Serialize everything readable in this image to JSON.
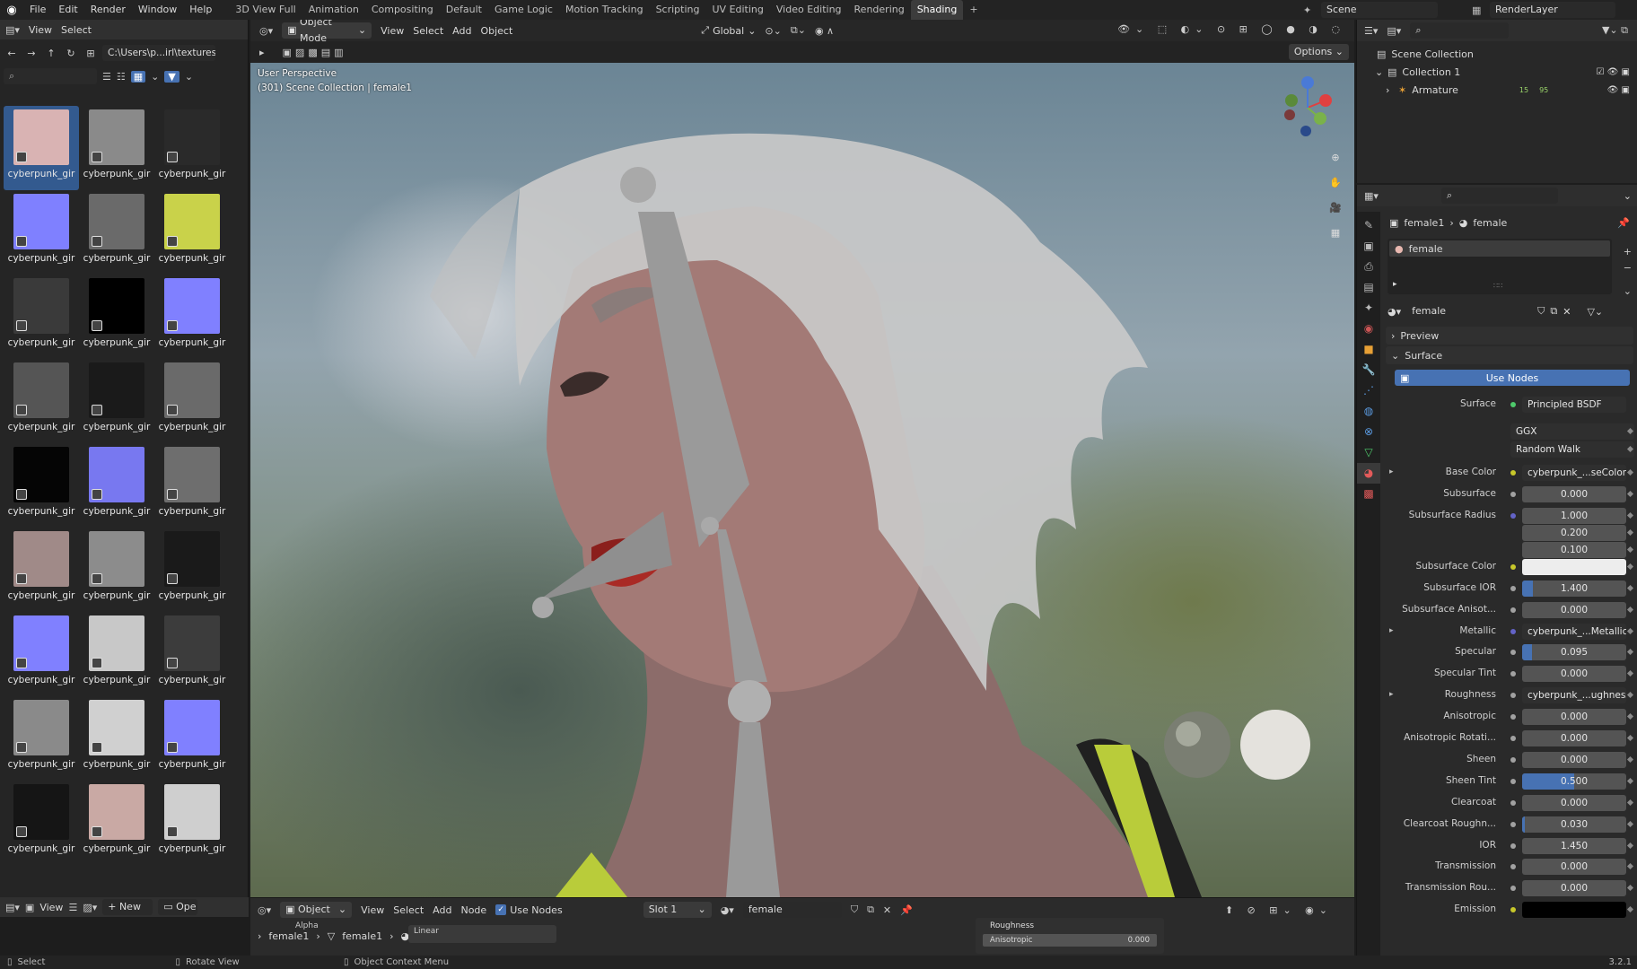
{
  "topbar": {
    "menus": [
      "File",
      "Edit",
      "Render",
      "Window",
      "Help"
    ],
    "workspaces": [
      "3D View Full",
      "Animation",
      "Compositing",
      "Default",
      "Game Logic",
      "Motion Tracking",
      "Scripting",
      "UV Editing",
      "Video Editing",
      "Rendering",
      "Shading"
    ],
    "active_workspace": "Shading",
    "add_workspace": "+",
    "scene_label": "Scene",
    "renderlayer_label": "RenderLayer"
  },
  "filebrowser": {
    "menus": [
      "View",
      "Select"
    ],
    "path": "C:\\Users\\p...irl\\textures\\",
    "search_placeholder": "",
    "thumbnails": [
      {
        "label": "cyberpunk_gir",
        "color": "#d9b3b3"
      },
      {
        "label": "cyberpunk_gir",
        "color": "#8a8a8a"
      },
      {
        "label": "cyberpunk_gir",
        "color": "#2a2a2a"
      },
      {
        "label": "cyberpunk_gir",
        "color": "#7f80ff"
      },
      {
        "label": "cyberpunk_gir",
        "color": "#6a6a6a"
      },
      {
        "label": "cyberpunk_gir",
        "color": "#c9d24a"
      },
      {
        "label": "cyberpunk_gir",
        "color": "#3a3a3a"
      },
      {
        "label": "cyberpunk_gir",
        "color": "#000000"
      },
      {
        "label": "cyberpunk_gir",
        "color": "#8080ff"
      },
      {
        "label": "cyberpunk_gir",
        "color": "#555555"
      },
      {
        "label": "cyberpunk_gir",
        "color": "#1a1a1a"
      },
      {
        "label": "cyberpunk_gir",
        "color": "#6a6a6a"
      },
      {
        "label": "cyberpunk_gir",
        "color": "#050505"
      },
      {
        "label": "cyberpunk_gir",
        "color": "#7878f0"
      },
      {
        "label": "cyberpunk_gir",
        "color": "#6e6e6e"
      },
      {
        "label": "cyberpunk_gir",
        "color": "#a08a88"
      },
      {
        "label": "cyberpunk_gir",
        "color": "#8c8c8c"
      },
      {
        "label": "cyberpunk_gir",
        "color": "#1a1a1a"
      },
      {
        "label": "cyberpunk_gir",
        "color": "#8080ff"
      },
      {
        "label": "cyberpunk_gir",
        "color": "#c8c8c8"
      },
      {
        "label": "cyberpunk_gir",
        "color": "#3c3c3c"
      },
      {
        "label": "cyberpunk_gir",
        "color": "#8a8a8a"
      },
      {
        "label": "cyberpunk_gir",
        "color": "#d0d0d0"
      },
      {
        "label": "cyberpunk_gir",
        "color": "#8080ff"
      },
      {
        "label": "cyberpunk_gir",
        "color": "#151515"
      },
      {
        "label": "cyberpunk_gir",
        "color": "#c9a9a4"
      },
      {
        "label": "cyberpunk_gir",
        "color": "#cfcfcf"
      }
    ],
    "bottom": {
      "view": "View",
      "new": "New",
      "open": "Ope"
    }
  },
  "viewport": {
    "mode": "Object Mode",
    "menus": [
      "View",
      "Select",
      "Add",
      "Object"
    ],
    "orientation": "Global",
    "options": "Options",
    "overlay_line1": "User Perspective",
    "overlay_line2": "(301) Scene Collection | female1"
  },
  "nodeeditor": {
    "editor_mode": "Object",
    "menus": [
      "View",
      "Select",
      "Add",
      "Node"
    ],
    "use_nodes": "Use Nodes",
    "slot": "Slot 1",
    "material": "female",
    "breadcrumb": [
      "female1",
      "female1",
      "female"
    ],
    "node_alpha": "Alpha",
    "node_linear": "Linear",
    "node_roughness": "Roughness",
    "node_anisotropic": "Anisotropic",
    "node_anisotropic_value": "0.000"
  },
  "outliner": {
    "items": [
      {
        "label": "Scene Collection",
        "level": 0
      },
      {
        "label": "Collection 1",
        "level": 1
      },
      {
        "label": "Armature",
        "level": 2
      }
    ],
    "armature_badges": [
      "15",
      "95"
    ]
  },
  "properties": {
    "breadcrumb_object": "female1",
    "breadcrumb_material": "female",
    "slot_name": "female",
    "material_name": "female",
    "panel_preview": "Preview",
    "panel_surface": "Surface",
    "use_nodes_button": "Use Nodes",
    "surface_label": "Surface",
    "surface_value": "Principled BSDF",
    "distribution": "GGX",
    "subsurface_method": "Random Walk",
    "rows": [
      {
        "label": "Base Color",
        "value": "cyberpunk_...seColor.png",
        "type": "tex",
        "dot": "#c7c72a",
        "expand": true
      },
      {
        "label": "Subsurface",
        "value": "0.000",
        "type": "num"
      },
      {
        "label": "Subsurface Radius",
        "value": "1.000",
        "type": "num",
        "dot": "#6363c7"
      },
      {
        "label": "",
        "value": "0.200",
        "type": "num",
        "nodot": true
      },
      {
        "label": "",
        "value": "0.100",
        "type": "num",
        "nodot": true
      },
      {
        "label": "Subsurface Color",
        "value": "",
        "type": "color",
        "dot": "#c7c72a"
      },
      {
        "label": "Subsurface IOR",
        "value": "1.400",
        "type": "num",
        "fill": 0.1
      },
      {
        "label": "Subsurface Anisot...",
        "value": "0.000",
        "type": "num"
      },
      {
        "label": "Metallic",
        "value": "cyberpunk_...Metallic.png",
        "type": "tex",
        "dot": "#6363c7",
        "expand": true
      },
      {
        "label": "Specular",
        "value": "0.095",
        "type": "num",
        "fill": 0.095
      },
      {
        "label": "Specular Tint",
        "value": "0.000",
        "type": "num"
      },
      {
        "label": "Roughness",
        "value": "cyberpunk_...ughness.png",
        "type": "tex",
        "expand": true
      },
      {
        "label": "Anisotropic",
        "value": "0.000",
        "type": "num"
      },
      {
        "label": "Anisotropic Rotati...",
        "value": "0.000",
        "type": "num"
      },
      {
        "label": "Sheen",
        "value": "0.000",
        "type": "num"
      },
      {
        "label": "Sheen Tint",
        "value": "0.500",
        "type": "num",
        "fill": 0.5
      },
      {
        "label": "Clearcoat",
        "value": "0.000",
        "type": "num"
      },
      {
        "label": "Clearcoat Roughn...",
        "value": "0.030",
        "type": "num",
        "fill": 0.03
      },
      {
        "label": "IOR",
        "value": "1.450",
        "type": "num"
      },
      {
        "label": "Transmission",
        "value": "0.000",
        "type": "num"
      },
      {
        "label": "Transmission Rou...",
        "value": "0.000",
        "type": "num"
      },
      {
        "label": "Emission",
        "value": "",
        "type": "black",
        "dot": "#c7c72a"
      }
    ]
  },
  "statusbar": {
    "select": "Select",
    "rotate": "Rotate View",
    "context": "Object Context Menu",
    "version": "3.2.1"
  }
}
